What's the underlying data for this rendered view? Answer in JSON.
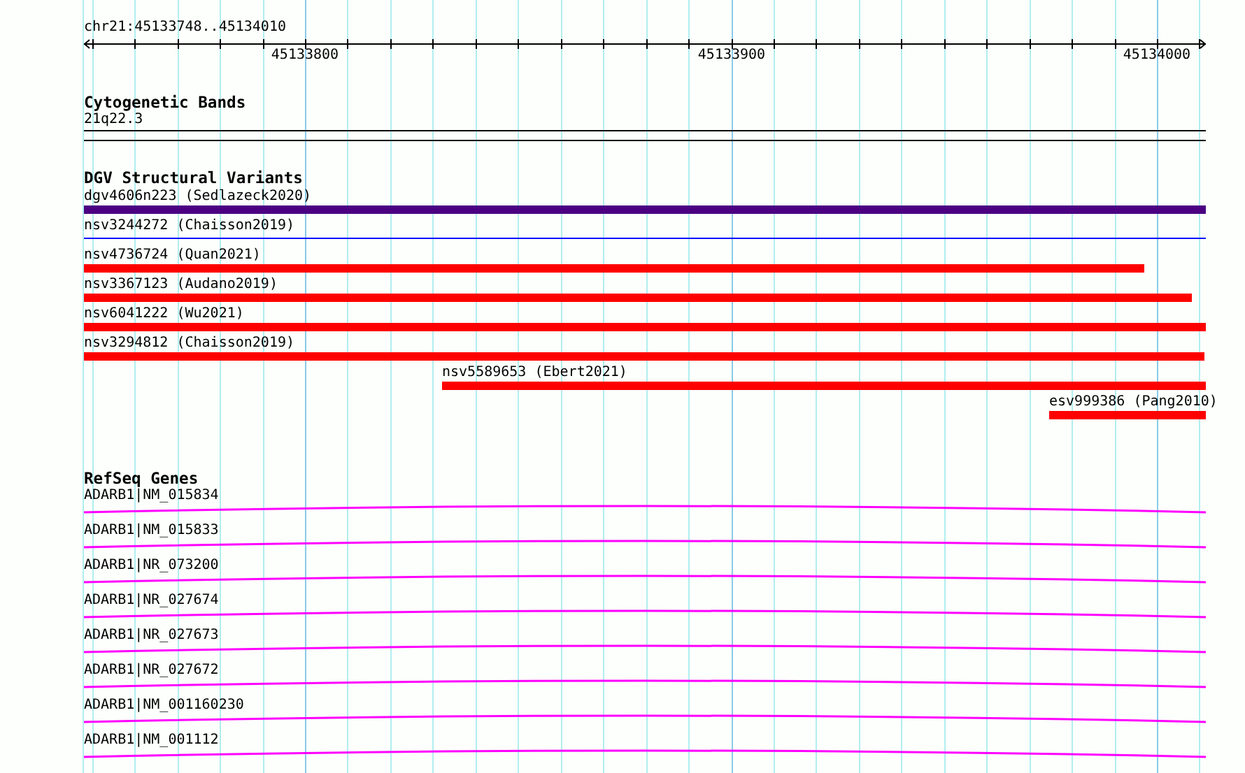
{
  "ruler": {
    "location": "chr21:45133748..45134010",
    "tick_labels": [
      "45133800",
      "45133900",
      "45134000"
    ]
  },
  "cytogenetic_bands": {
    "title": "Cytogenetic Bands",
    "bands": [
      {
        "label": "21q22.3"
      }
    ]
  },
  "dgv_structural_variants": {
    "title": "DGV Structural Variants",
    "features": [
      {
        "label": "dgv4606n223 (Sedlazeck2020)",
        "kind": "bar",
        "color": "#4b0082"
      },
      {
        "label": "nsv3244272 (Chaisson2019)",
        "kind": "line",
        "color": "#0000ff"
      },
      {
        "label": "nsv4736724 (Quan2021)",
        "kind": "bar",
        "color": "#ff0000"
      },
      {
        "label": "nsv3367123 (Audano2019)",
        "kind": "bar",
        "color": "#ff0000"
      },
      {
        "label": "nsv6041222 (Wu2021)",
        "kind": "bar",
        "color": "#ff0000"
      },
      {
        "label": "nsv3294812 (Chaisson2019)",
        "kind": "bar",
        "color": "#ff0000"
      },
      {
        "label": "nsv5589653 (Ebert2021)",
        "kind": "bar",
        "color": "#ff0000"
      },
      {
        "label": "esv999386 (Pang2010)",
        "kind": "bar",
        "color": "#ff0000"
      }
    ]
  },
  "refseq_genes": {
    "title": "RefSeq Genes",
    "features": [
      {
        "label": "ADARB1|NM_015834"
      },
      {
        "label": "ADARB1|NM_015833"
      },
      {
        "label": "ADARB1|NR_073200"
      },
      {
        "label": "ADARB1|NR_027674"
      },
      {
        "label": "ADARB1|NR_027673"
      },
      {
        "label": "ADARB1|NR_027672"
      },
      {
        "label": "ADARB1|NM_001160230"
      },
      {
        "label": "ADARB1|NM_001112"
      }
    ]
  }
}
